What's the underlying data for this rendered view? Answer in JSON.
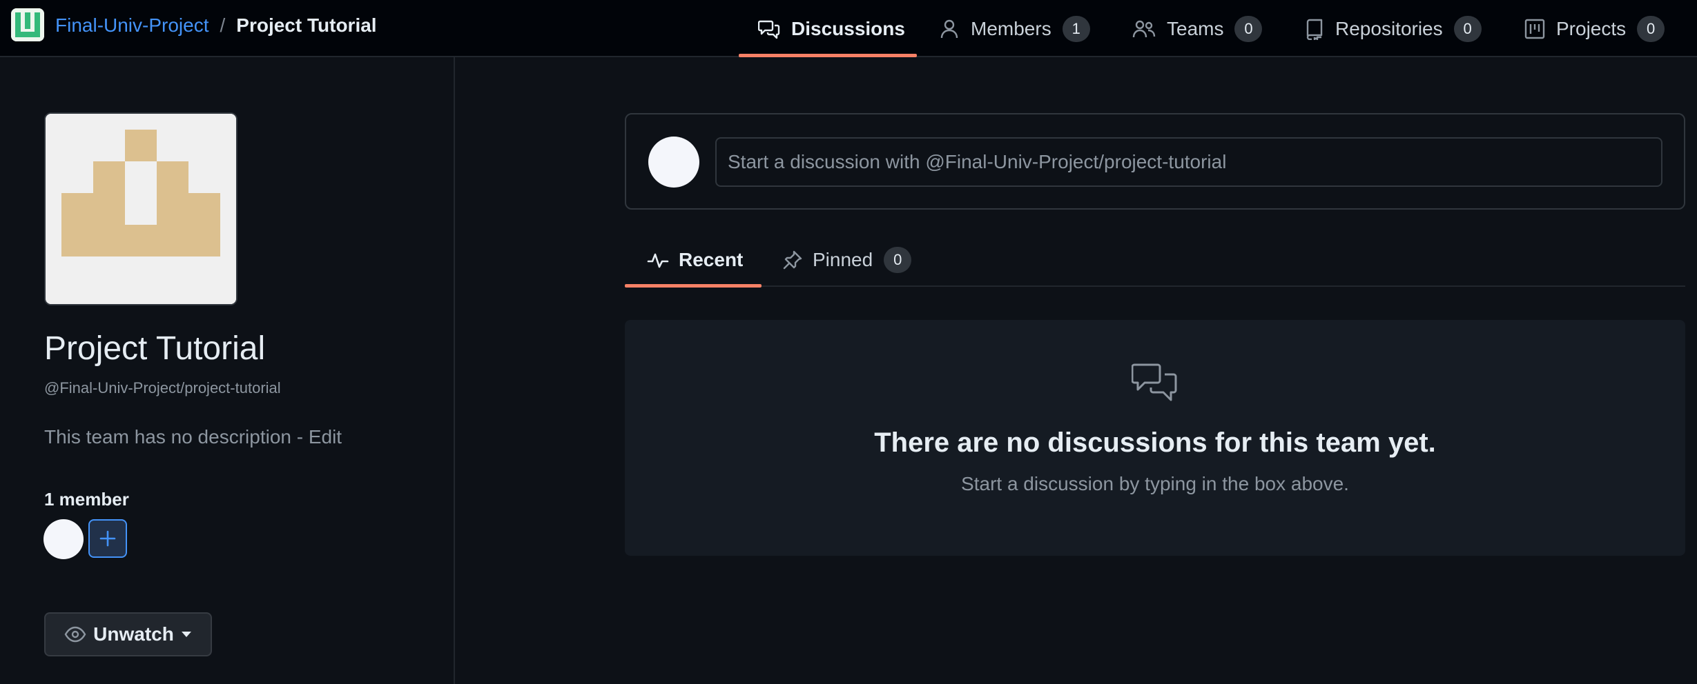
{
  "breadcrumb": {
    "org": "Final-Univ-Project",
    "separator": "/",
    "team": "Project Tutorial"
  },
  "tabs": [
    {
      "label": "Discussions",
      "icon": "comment-discussion-icon",
      "active": true
    },
    {
      "label": "Members",
      "icon": "person-icon",
      "count": "1"
    },
    {
      "label": "Teams",
      "icon": "people-icon",
      "count": "0"
    },
    {
      "label": "Repositories",
      "icon": "repo-icon",
      "count": "0"
    },
    {
      "label": "Projects",
      "icon": "project-icon",
      "count": "0"
    }
  ],
  "sidebar": {
    "team_name": "Project Tutorial",
    "team_handle": "@Final-Univ-Project/project-tutorial",
    "description": "This team has no description - Edit",
    "member_count": "1 member",
    "unwatch_label": "Unwatch"
  },
  "composer": {
    "placeholder": "Start a discussion with @Final-Univ-Project/project-tutorial"
  },
  "subtabs": [
    {
      "label": "Recent",
      "icon": "pulse-icon",
      "active": true
    },
    {
      "label": "Pinned",
      "icon": "pin-icon",
      "count": "0"
    }
  ],
  "blankslate": {
    "icon": "comment-discussion-icon",
    "title": "There are no discussions for this team yet.",
    "subtitle": "Start a discussion by typing in the box above."
  },
  "colors": {
    "accent_underline": "#f78166",
    "link": "#4493f8",
    "background": "#0d1117",
    "avatar_tan": "#dcc08f"
  }
}
